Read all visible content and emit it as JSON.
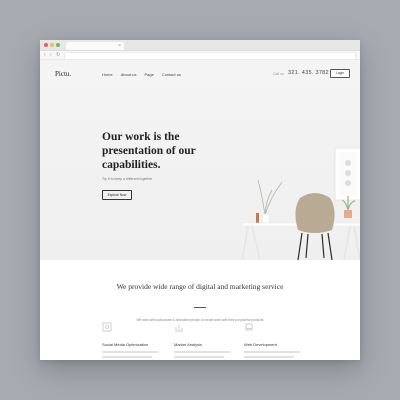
{
  "browser": {
    "tab_close": "×",
    "back": "‹",
    "forward": "›",
    "reload": "↻"
  },
  "site": {
    "logo": "Pictu.",
    "nav": [
      "Home",
      "About us",
      "Page",
      "Contact us"
    ],
    "phone_label": "Call us",
    "phone": "321. 435. 3782",
    "header_button": "Login"
  },
  "hero": {
    "title": "Our work is the presentation of our capabilities.",
    "subtitle": "Try it to keep a different together",
    "button": "Explore Now"
  },
  "services": {
    "heading": "We provide wide range of digital and marketing service",
    "subtitle": "We work with passionate & dedicated people to create work with their purposeful products",
    "items": [
      {
        "title": "Social Media Optimization",
        "icon": "share-icon"
      },
      {
        "title": "Market Analysis",
        "icon": "chart-icon"
      },
      {
        "title": "Web Development",
        "icon": "laptop-icon"
      }
    ]
  },
  "colors": {
    "backdrop": "#a7abb1",
    "hero_bg": "#f1f1f1",
    "chair": "#b9aa93",
    "text_dark": "#222222"
  }
}
